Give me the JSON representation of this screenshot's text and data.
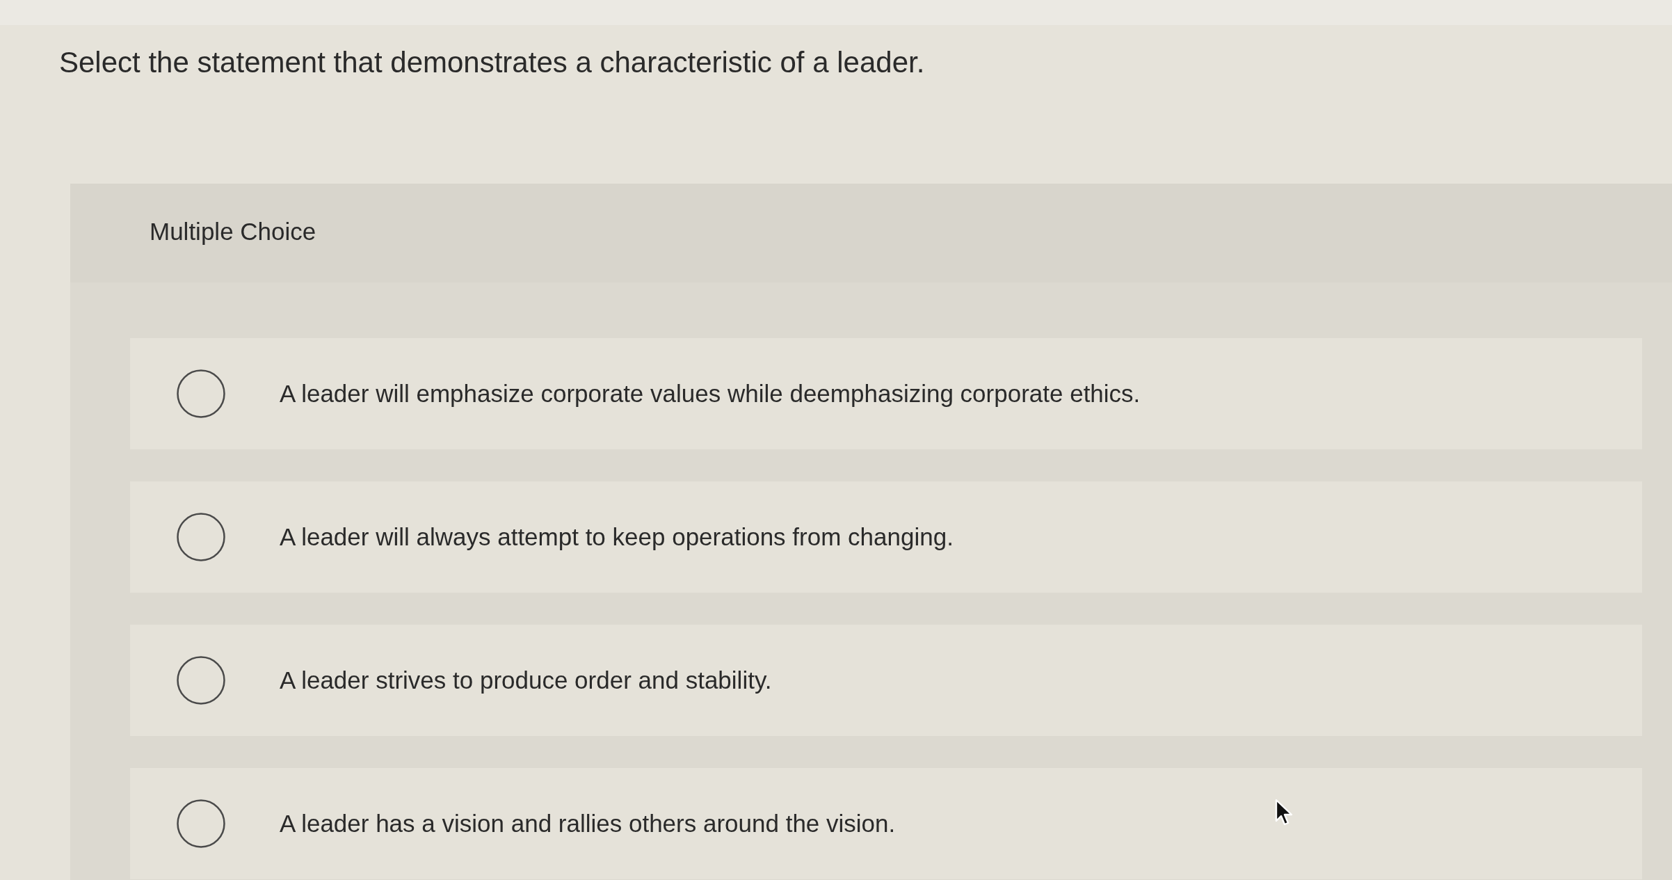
{
  "question": {
    "text": "Select the statement that demonstrates a characteristic of a leader."
  },
  "multiple_choice": {
    "title": "Multiple Choice",
    "options": [
      {
        "text": "A leader will emphasize corporate values while deemphasizing corporate ethics.",
        "selected": false
      },
      {
        "text": "A leader will always attempt to keep operations from changing.",
        "selected": false
      },
      {
        "text": "A leader strives to produce order and stability.",
        "selected": false
      },
      {
        "text": "A leader has a vision and rallies others around the vision.",
        "selected": false
      }
    ]
  }
}
